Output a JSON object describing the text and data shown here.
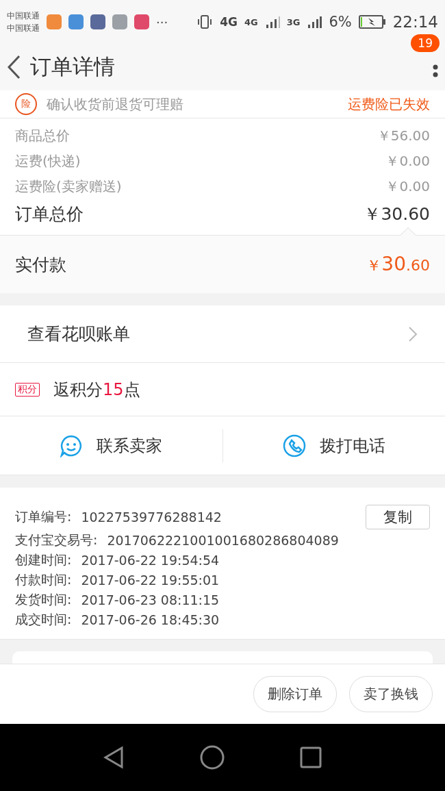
{
  "status_bar": {
    "carriers": [
      "中国联通",
      "中国联通"
    ],
    "more": "···",
    "network_1": "4G",
    "network_2": "4G",
    "network_3": "3G",
    "battery": "6%",
    "time": "22:14"
  },
  "header": {
    "title": "订单详情",
    "badge": "19"
  },
  "insurance": {
    "icon": "险",
    "note": "确认收货前退货可理赔",
    "status": "运费险已失效"
  },
  "prices": [
    {
      "label": "商品总价",
      "value": "￥56.00",
      "kind": "minor"
    },
    {
      "label": "运费(快递)",
      "value": "￥0.00",
      "kind": "minor"
    },
    {
      "label": "运费险(卖家赠送)",
      "value": "￥0.00",
      "kind": "minor"
    },
    {
      "label": "订单总价",
      "value": "￥30.60",
      "kind": "total"
    }
  ],
  "paid": {
    "label": "实付款",
    "currency": "￥",
    "integer": "30",
    "decimal": ".60"
  },
  "huabei": {
    "label": "查看花呗账单"
  },
  "points": {
    "tag": "积分",
    "before": "返积分",
    "count": "15",
    "after": "点"
  },
  "contacts": [
    {
      "label": "联系卖家",
      "kind": "chat"
    },
    {
      "label": "拨打电话",
      "kind": "phone"
    }
  ],
  "order_info": {
    "copy_button": "复制",
    "rows": [
      {
        "label": "订单编号:",
        "value": "10227539776288142"
      },
      {
        "label": "支付宝交易号:",
        "value": "2017062221001001680286804089"
      },
      {
        "label": "创建时间:",
        "value": "2017-06-22 19:54:54"
      },
      {
        "label": "付款时间:",
        "value": "2017-06-22 19:55:01"
      },
      {
        "label": "发货时间:",
        "value": "2017-06-23 08:11:15"
      },
      {
        "label": "成交时间:",
        "value": "2017-06-26 18:45:30"
      }
    ]
  },
  "actions": [
    "删除订单",
    "卖了换钱"
  ]
}
